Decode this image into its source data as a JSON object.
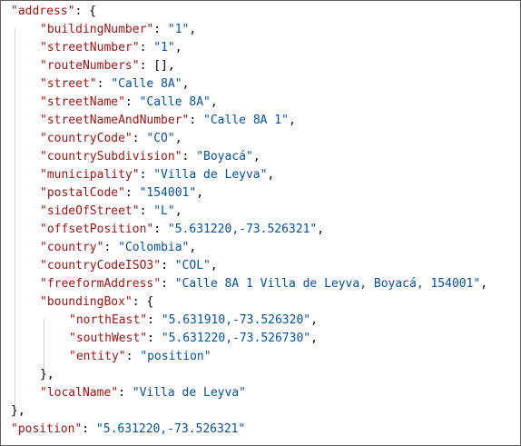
{
  "colors": {
    "key": "#a31515",
    "string": "#0451a5",
    "punctuation": "#000000",
    "guide": "#d6d6d6",
    "border": "#5f5f5f"
  },
  "lines": [
    {
      "indent": 0,
      "key": "\"address\"",
      "sep": ": ",
      "value": "",
      "after": "{"
    },
    {
      "indent": 1,
      "key": "\"buildingNumber\"",
      "sep": ": ",
      "value": "\"1\"",
      "after": ","
    },
    {
      "indent": 1,
      "key": "\"streetNumber\"",
      "sep": ": ",
      "value": "\"1\"",
      "after": ","
    },
    {
      "indent": 1,
      "key": "\"routeNumbers\"",
      "sep": ": ",
      "value": "",
      "after": "[],"
    },
    {
      "indent": 1,
      "key": "\"street\"",
      "sep": ": ",
      "value": "\"Calle 8A\"",
      "after": ","
    },
    {
      "indent": 1,
      "key": "\"streetName\"",
      "sep": ": ",
      "value": "\"Calle 8A\"",
      "after": ","
    },
    {
      "indent": 1,
      "key": "\"streetNameAndNumber\"",
      "sep": ": ",
      "value": "\"Calle 8A 1\"",
      "after": ","
    },
    {
      "indent": 1,
      "key": "\"countryCode\"",
      "sep": ": ",
      "value": "\"CO\"",
      "after": ","
    },
    {
      "indent": 1,
      "key": "\"countrySubdivision\"",
      "sep": ": ",
      "value": "\"Boyacá\"",
      "after": ","
    },
    {
      "indent": 1,
      "key": "\"municipality\"",
      "sep": ": ",
      "value": "\"Villa de Leyva\"",
      "after": ","
    },
    {
      "indent": 1,
      "key": "\"postalCode\"",
      "sep": ": ",
      "value": "\"154001\"",
      "after": ","
    },
    {
      "indent": 1,
      "key": "\"sideOfStreet\"",
      "sep": ": ",
      "value": "\"L\"",
      "after": ","
    },
    {
      "indent": 1,
      "key": "\"offsetPosition\"",
      "sep": ": ",
      "value": "\"5.631220,-73.526321\"",
      "after": ","
    },
    {
      "indent": 1,
      "key": "\"country\"",
      "sep": ": ",
      "value": "\"Colombia\"",
      "after": ","
    },
    {
      "indent": 1,
      "key": "\"countryCodeISO3\"",
      "sep": ": ",
      "value": "\"COL\"",
      "after": ","
    },
    {
      "indent": 1,
      "key": "\"freeformAddress\"",
      "sep": ": ",
      "value": "\"Calle 8A 1 Villa de Leyva, Boyacá, 154001\"",
      "after": ","
    },
    {
      "indent": 1,
      "key": "\"boundingBox\"",
      "sep": ": ",
      "value": "",
      "after": "{"
    },
    {
      "indent": 2,
      "key": "\"northEast\"",
      "sep": ": ",
      "value": "\"5.631910,-73.526320\"",
      "after": ","
    },
    {
      "indent": 2,
      "key": "\"southWest\"",
      "sep": ": ",
      "value": "\"5.631220,-73.526730\"",
      "after": ","
    },
    {
      "indent": 2,
      "key": "\"entity\"",
      "sep": ": ",
      "value": "\"position\"",
      "after": ""
    },
    {
      "indent": 1,
      "key": "",
      "sep": "",
      "value": "",
      "after": "},"
    },
    {
      "indent": 1,
      "key": "\"localName\"",
      "sep": ": ",
      "value": "\"Villa de Leyva\"",
      "after": ""
    },
    {
      "indent": 0,
      "key": "",
      "sep": "",
      "value": "",
      "after": "},"
    },
    {
      "indent": 0,
      "key": "\"position\"",
      "sep": ": ",
      "value": "\"5.631220,-73.526321\"",
      "after": ""
    }
  ]
}
